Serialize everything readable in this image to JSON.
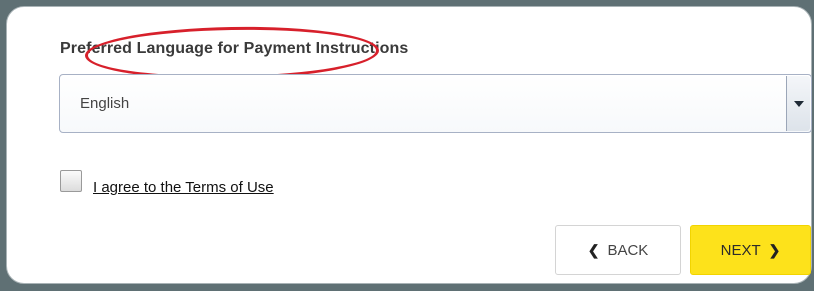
{
  "form": {
    "language_label": "Preferred Language for Payment Instructions",
    "language_select": {
      "selected": "English"
    },
    "terms_checkbox": {
      "checked": false,
      "label": "I agree to the Terms of Use"
    }
  },
  "navigation": {
    "back_label": "BACK",
    "next_label": "NEXT",
    "back_icon": "chevron-left-icon",
    "next_icon": "chevron-right-icon"
  },
  "annotation": {
    "highlight_color": "#d7202b"
  },
  "colors": {
    "next_button": "#fde21b",
    "background": "#5f7074"
  }
}
